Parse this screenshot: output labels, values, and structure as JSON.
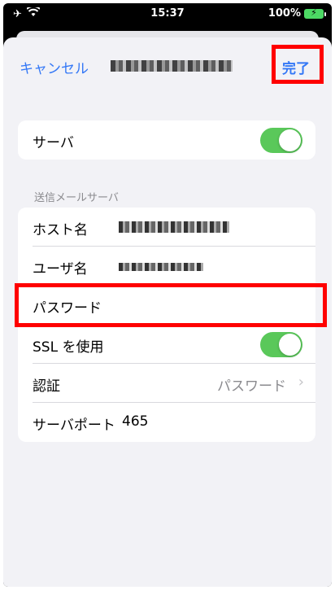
{
  "status_bar": {
    "time": "15:37",
    "battery_text": "100%"
  },
  "nav": {
    "cancel_label": "キャンセル",
    "done_label": "完了"
  },
  "server_toggle": {
    "label": "サーバ",
    "on": true
  },
  "outgoing_section": {
    "header": "送信メールサーバ",
    "host_label": "ホスト名",
    "user_label": "ユーザ名",
    "password_label": "パスワード",
    "ssl_label": "SSL を使用",
    "ssl_on": true,
    "auth_label": "認証",
    "auth_value": "パスワード",
    "port_label": "サーバポート",
    "port_value": "465"
  },
  "colors": {
    "accent": "#3478f6",
    "toggle_on": "#5ac85a",
    "highlight": "#ff0000"
  }
}
